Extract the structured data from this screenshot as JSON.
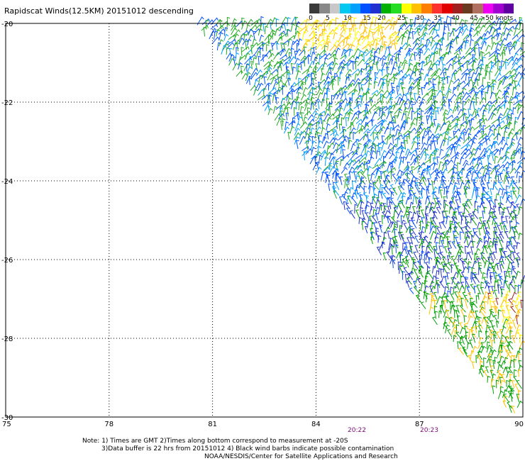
{
  "title": "Rapidscat Winds(12.5KM) 20151012 descending",
  "colorbar": {
    "swatches": [
      "#3a3a3a",
      "#888888",
      "#c8c8c8",
      "#00c8f0",
      "#00a0ff",
      "#0050ff",
      "#2030d0",
      "#00b000",
      "#22dd22",
      "#ffff00",
      "#ffc000",
      "#ff8000",
      "#ff3030",
      "#e00000",
      "#a02020",
      "#6a3a20",
      "#b07060",
      "#f000f0",
      "#a000d0",
      "#6000a0"
    ],
    "labels": [
      "0",
      "5",
      "10",
      "15",
      "20",
      "25",
      "30",
      "35",
      "40",
      "45",
      ">50 knots"
    ]
  },
  "axes": {
    "lon_ticks": [
      "75",
      "78",
      "81",
      "84",
      "87",
      "90"
    ],
    "lat_ticks": [
      "-20",
      "-22",
      "-24",
      "-26",
      "-28",
      "-30"
    ]
  },
  "times": [
    "20:22",
    "20:23"
  ],
  "notes": {
    "line1": "Note: 1) Times are GMT 2)Times along bottom correspond to measurement at -20S",
    "line2": "3)Data buffer is 22 hrs from 20151012 4) Black wind barbs indicate possible contamination",
    "line3": "NOAA/NESDIS/Center for Satellite Applications and Research"
  }
}
